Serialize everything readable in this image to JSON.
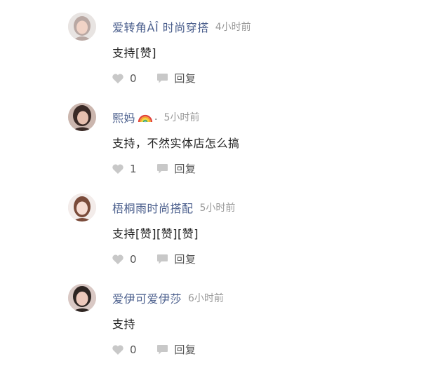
{
  "comments": [
    {
      "username": "爱转角ÀÎ 时尚穿搭",
      "time": "4小时前",
      "content": "支持[赞]",
      "likes": "0",
      "reply_label": "回复",
      "avatar": "avatar-woman-light-hair",
      "skin": "#f1d3c6",
      "hair": "#b9a8a3"
    },
    {
      "username": "熙妈",
      "badge": "rainbow-emoji",
      "separator": ".",
      "time": "5小时前",
      "content": "支持，不然实体店怎么搞",
      "likes": "1",
      "reply_label": "回复",
      "avatar": "avatar-woman-dark-hair",
      "skin": "#e6bfae",
      "hair": "#3a2a26"
    },
    {
      "username": "梧桐雨时尚搭配",
      "time": "5小时前",
      "content": "支持[赞][赞][赞]",
      "likes": "0",
      "reply_label": "回复",
      "avatar": "avatar-woman-brown-hair",
      "skin": "#f6dcd2",
      "hair": "#7a4b3a"
    },
    {
      "username": "爱伊可爱伊莎",
      "time": "6小时前",
      "content": "支持",
      "likes": "0",
      "reply_label": "回复",
      "avatar": "avatar-woman-dark-hair",
      "skin": "#edc8bb",
      "hair": "#2e2522"
    }
  ],
  "colors": {
    "username": "#4a5e8c",
    "time": "#999999",
    "content": "#222222",
    "icon": "#c8c8c8"
  },
  "icons": {
    "like": "heart-icon",
    "reply": "speech-bubble-icon"
  }
}
